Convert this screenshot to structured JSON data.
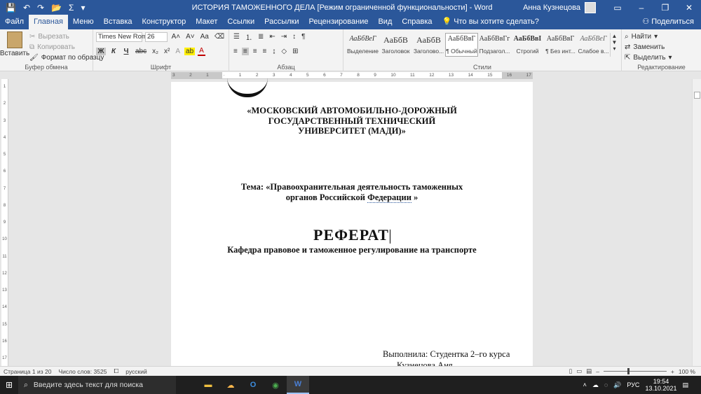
{
  "titlebar": {
    "title": "ИСТОРИЯ ТАМОЖЕННОГО ДЕЛА [Режим ограниченной функциональности]  -  Word",
    "user": "Анна Кузнецова"
  },
  "tabs": [
    "Файл",
    "Главная",
    "Меню",
    "Вставка",
    "Конструктор",
    "Макет",
    "Ссылки",
    "Рассылки",
    "Рецензирование",
    "Вид",
    "Справка",
    "Что вы хотите сделать?"
  ],
  "share": "Поделиться",
  "clipboard": {
    "paste": "Вставить",
    "cut": "Вырезать",
    "copy": "Копировать",
    "format_painter": "Формат по образцу",
    "label": "Буфер обмена"
  },
  "font": {
    "name": "Times New Rom",
    "size": "26",
    "label": "Шрифт"
  },
  "paragraph": {
    "label": "Абзац"
  },
  "styles": {
    "label": "Стили",
    "items": [
      {
        "sample": "АаБбВеГ",
        "name": "Выделение"
      },
      {
        "sample": "АаБбВ",
        "name": "Заголовок"
      },
      {
        "sample": "АаБбВ",
        "name": "Заголово..."
      },
      {
        "sample": "АаБбВвГ",
        "name": "¶ Обычный"
      },
      {
        "sample": "АаБбВвГг",
        "name": "Подзагол..."
      },
      {
        "sample": "АаБбВвI",
        "name": "Строгий"
      },
      {
        "sample": "АаБбВвГ",
        "name": "¶ Без инт..."
      },
      {
        "sample": "АаБбВеГ",
        "name": "Слабое в..."
      }
    ]
  },
  "editing": {
    "find": "Найти",
    "replace": "Заменить",
    "select": "Выделить",
    "label": "Редактирование"
  },
  "document": {
    "university": "«МОСКОВСКИЙ АВТОМОБИЛЬНО-ДОРОЖНЫЙ ГОСУДАРСТВЕННЫЙ ТЕХНИЧЕСКИЙ УНИВЕРСИТЕТ (МАДИ)»",
    "topic_prefix": "Тема: «Правоохранительная деятельность таможенных органов Российской ",
    "topic_word": "Федерации",
    "topic_suffix": "  »",
    "referat": "РЕФЕРАТ",
    "department": "Кафедра правовое и таможенное регулирование на транспорте",
    "done_by": "Выполнила: Студентка 2–го курса",
    "student": "Кузнецова Аня"
  },
  "status": {
    "page": "Страница 1 из 20",
    "words": "Число слов: 3525",
    "language": "русский",
    "zoom": "100 %"
  },
  "taskbar": {
    "search": "Введите здесь текст для поиска",
    "lang": "РУС",
    "time": "19:54",
    "date": "13.10.2021"
  }
}
